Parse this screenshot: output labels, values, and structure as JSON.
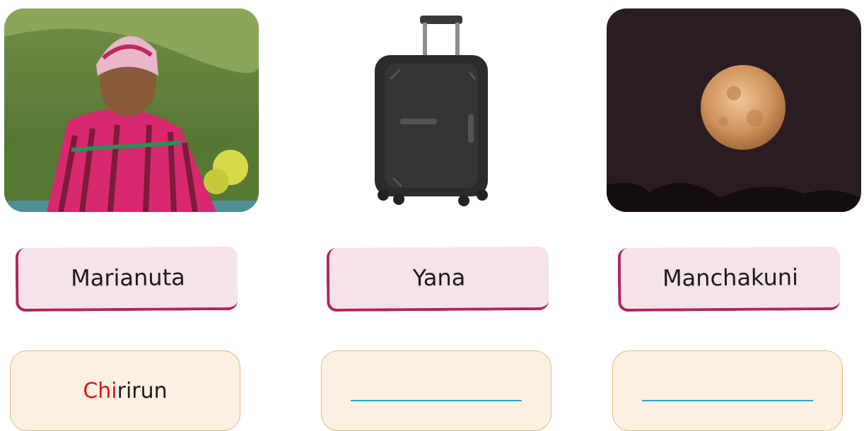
{
  "cards": [
    {
      "image": "andean-man-in-poncho",
      "word": "Marianuta",
      "answer": {
        "highlight": "Chi",
        "rest": "rirun"
      }
    },
    {
      "image": "black-suitcase",
      "word": "Yana",
      "answer": null
    },
    {
      "image": "full-moon",
      "word": "Manchakuni",
      "answer": null
    }
  ]
}
